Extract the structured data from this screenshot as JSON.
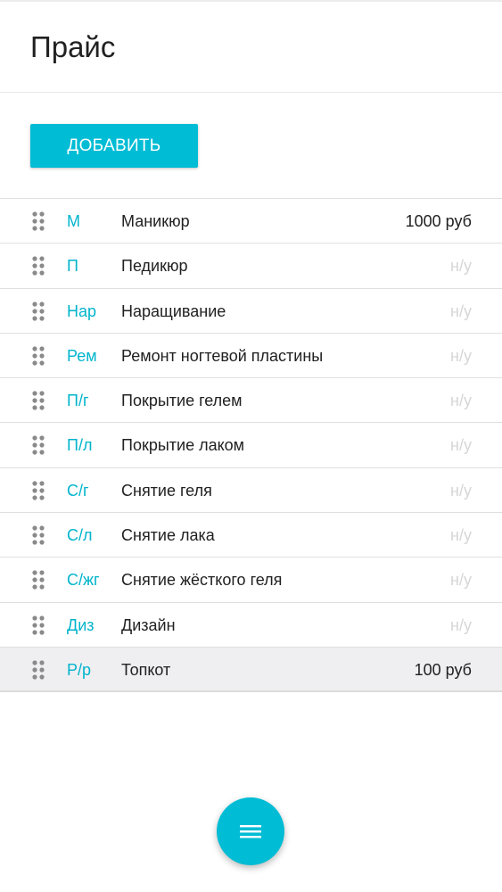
{
  "header": {
    "title": "Прайс"
  },
  "toolbar": {
    "add_label": "ДОБАВИТЬ"
  },
  "colors": {
    "accent": "#00bcd4",
    "na_text": "#d6d6d6",
    "selected_row": "#efeff2"
  },
  "price_list": [
    {
      "abbr": "М",
      "name": "Маникюр",
      "price": "1000 руб",
      "available": true
    },
    {
      "abbr": "П",
      "name": "Педикюр",
      "price": "н/у",
      "available": false
    },
    {
      "abbr": "Нар",
      "name": "Наращивание",
      "price": "н/у",
      "available": false
    },
    {
      "abbr": "Рем",
      "name": "Ремонт ногтевой пластины",
      "price": "н/у",
      "available": false
    },
    {
      "abbr": "П/г",
      "name": "Покрытие гелем",
      "price": "н/у",
      "available": false
    },
    {
      "abbr": "П/л",
      "name": "Покрытие лаком",
      "price": "н/у",
      "available": false
    },
    {
      "abbr": "С/г",
      "name": "Снятие геля",
      "price": "н/у",
      "available": false
    },
    {
      "abbr": "С/л",
      "name": "Снятие лака",
      "price": "н/у",
      "available": false
    },
    {
      "abbr": "С/жг",
      "name": "Снятие жёсткого геля",
      "price": "н/у",
      "available": false
    },
    {
      "abbr": "Диз",
      "name": "Дизайн",
      "price": "н/у",
      "available": false
    },
    {
      "abbr": "Р/р",
      "name": "Топкот",
      "price": "100 руб",
      "available": true,
      "selected": true
    }
  ],
  "fab": {
    "icon": "menu-icon"
  }
}
